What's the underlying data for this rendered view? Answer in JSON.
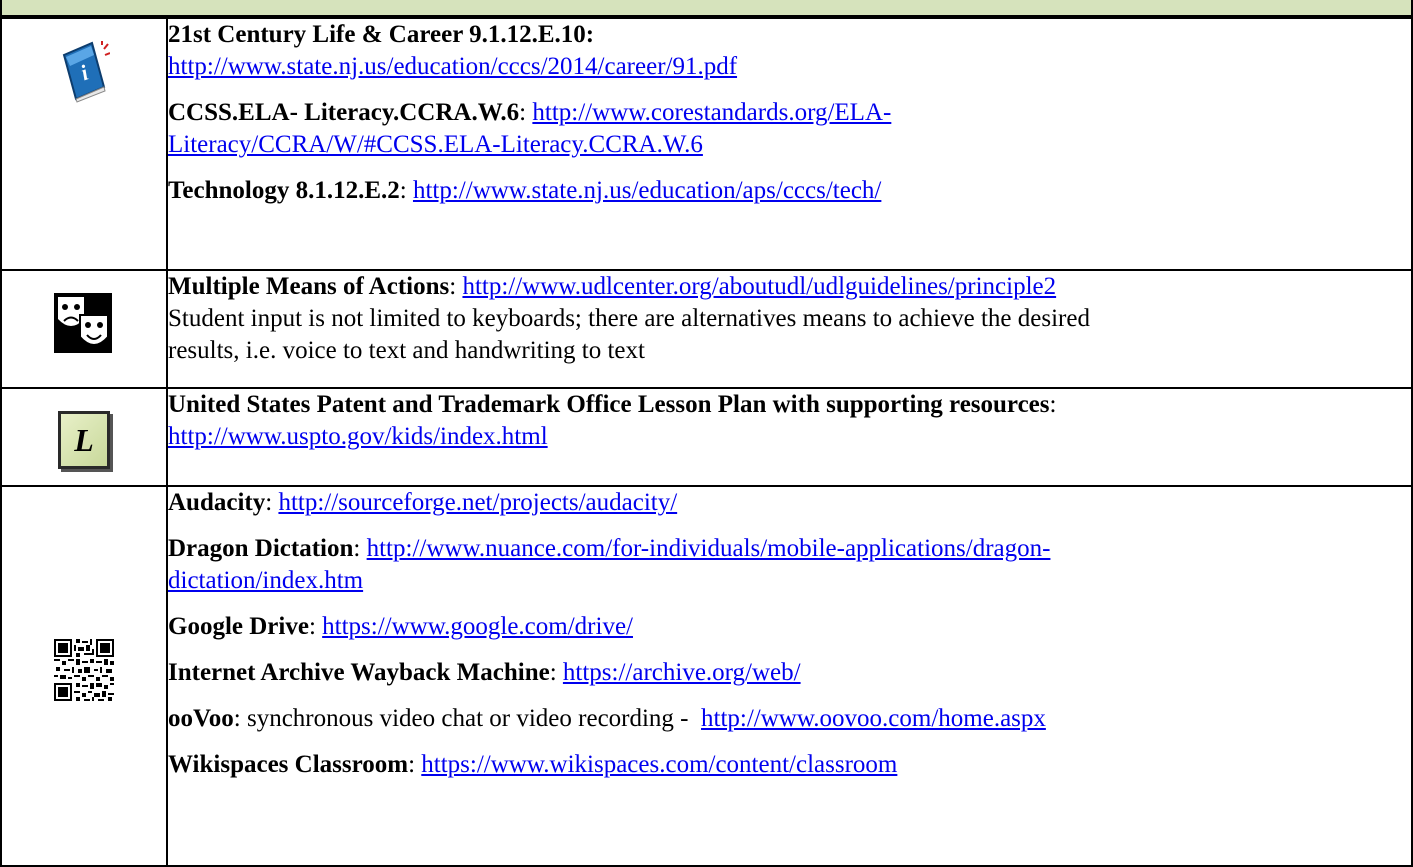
{
  "rows": [
    {
      "icon": "info-book-icon",
      "entries": [
        {
          "label": "21st Century Life & Career 9.1.12.E.10",
          "sep": ":",
          "text": "",
          "url": "http://www.state.nj.us/education/cccs/2014/career/91.pdf",
          "url_wrap": [
            "http://www.state.nj.us/education/cccs/2014/career/91.pdf"
          ]
        },
        {
          "label": "CCSS.ELA- Literacy.CCRA.W.6",
          "sep": ": ",
          "text": "",
          "url": "http://www.corestandards.org/ELA-Literacy/CCRA/W/#CCSS.ELA-Literacy.CCRA.W.6",
          "url_wrap": [
            "http://www.corestandards.org/ELA-",
            "Literacy/CCRA/W/#CCSS.ELA-Literacy.CCRA.W.6"
          ]
        },
        {
          "label": "Technology 8.1.12.E.2",
          "sep": ": ",
          "text": "",
          "url": "http://www.state.nj.us/education/aps/cccs/tech/"
        }
      ]
    },
    {
      "icon": "theater-masks-icon",
      "entries": [
        {
          "label": "Multiple Means of Actions",
          "sep": ": ",
          "url": "http://www.udlcenter.org/aboutudl/udlguidelines/principle2",
          "description": "Student input is not limited to keyboards; there are alternatives means to achieve the desired results, i.e. voice to text and handwriting to text",
          "description_wrap": [
            "Student input is not limited to keyboards; there are alternatives means to achieve the desired",
            "results, i.e. voice to text and handwriting to text"
          ]
        }
      ]
    },
    {
      "icon": "lesson-plan-icon",
      "icon_letter": "L",
      "entries": [
        {
          "label": "United States Patent and Trademark Office Lesson Plan with supporting resources",
          "sep": ":",
          "url": "http://www.uspto.gov/kids/index.html"
        }
      ]
    },
    {
      "icon": "qr-code-icon",
      "entries": [
        {
          "label": "Audacity",
          "sep": ": ",
          "text": "",
          "url": "http://sourceforge.net/projects/audacity/"
        },
        {
          "label": "Dragon Dictation",
          "sep": ": ",
          "text": "",
          "url": "http://www.nuance.com/for-individuals/mobile-applications/dragon-dictation/index.htm",
          "url_wrap": [
            "http://www.nuance.com/for-individuals/mobile-applications/dragon-",
            "dictation/index.htm"
          ]
        },
        {
          "label": "Google Drive",
          "sep": ": ",
          "text": "",
          "url": "https://www.google.com/drive/"
        },
        {
          "label": "Internet Archive Wayback Machine",
          "sep": ": ",
          "text": "",
          "url": "https://archive.org/web/"
        },
        {
          "label": "ooVoo",
          "sep": ": ",
          "text": "synchronous video chat or video recording -  ",
          "url": "http://www.oovoo.com/home.aspx"
        },
        {
          "label": "Wikispaces Classroom",
          "sep": ": ",
          "text": "",
          "url": "https://www.wikispaces.com/content/classroom"
        }
      ]
    }
  ]
}
